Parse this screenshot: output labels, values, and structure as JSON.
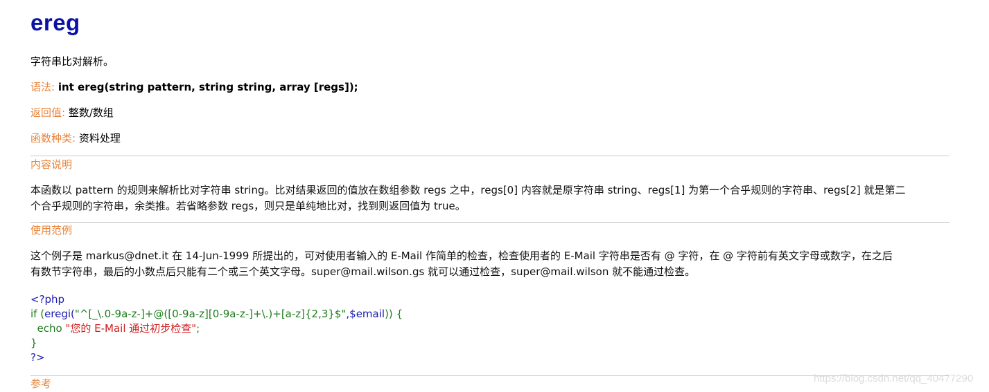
{
  "title": "ereg",
  "summary": "字符串比对解析。",
  "syntax": {
    "label": "语法:",
    "value": "int ereg(string pattern, string string, array [regs]);"
  },
  "return_value": {
    "label": "返回值:",
    "value": "整数/数组"
  },
  "function_type": {
    "label": "函数种类:",
    "value": "资料处理"
  },
  "description": {
    "heading": "内容说明",
    "lines": [
      "本函数以 pattern 的规则来解析比对字符串 string。比对结果返回的值放在数组参数 regs 之中，regs[0] 内容就是原字符串 string、regs[1] 为第一个合乎规则的字符串、regs[2] 就是第二",
      "个合乎规则的字符串，余类推。若省略参数 regs，则只是单纯地比对，找到则返回值为 true。"
    ]
  },
  "example": {
    "heading": "使用范例",
    "lines": [
      "这个例子是 markus@dnet.it 在 14-Jun-1999 所提出的，可对使用者输入的 E-Mail 作简单的检查，检查使用者的 E-Mail 字符串是否有 @ 字符，在 @ 字符前有英文字母或数字，在之后",
      "有数节字符串，最后的小数点后只能有二个或三个英文字母。super@mail.wilson.gs 就可以通过检查，super@mail.wilson 就不能通过检查。"
    ],
    "code": {
      "open_tag": "<?php",
      "if_kw": "if (",
      "fn": "eregi(",
      "pattern": "\"^[_\\.0-9a-z-]+@([0-9a-z][0-9a-z-]+\\.)+[a-z]{2,3}$\"",
      "var": ",$email",
      "close_paren": "))",
      "brace_open": " {",
      "echo_indent": "  echo ",
      "echo_str": "\"您的 E-Mail 通过初步检查\"",
      "semicolon": ";",
      "brace_close": "}",
      "close_tag": "?>"
    }
  },
  "reference": {
    "heading": "参考"
  },
  "watermark": "https://blog.csdn.net/qq_40477290",
  "colors": {
    "title": "#0a12a5",
    "label": "#e8833a",
    "code_keyword": "#1b1bb0",
    "code_green": "#1e7d1e",
    "code_string": "#d01c1c"
  }
}
